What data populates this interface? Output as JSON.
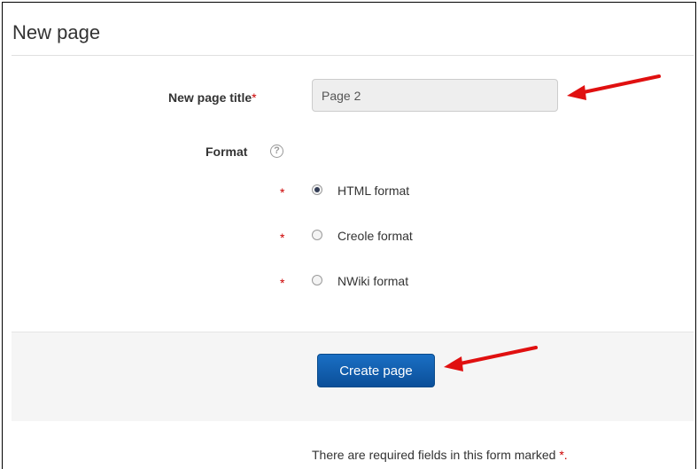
{
  "page": {
    "title": "New page"
  },
  "form": {
    "title_label": "New page title",
    "required_marker": "*",
    "title_value": "Page 2",
    "format_label": "Format",
    "help_glyph": "?",
    "formats": [
      {
        "label": "HTML format",
        "checked": true
      },
      {
        "label": "Creole format",
        "checked": false
      },
      {
        "label": "NWiki format",
        "checked": false
      }
    ],
    "submit_label": "Create page",
    "required_note": "There are required fields in this form marked",
    "required_note_marker": "*."
  },
  "colors": {
    "accent": "#0b4f99",
    "required": "#cc0000",
    "annotation_arrow": "#e01010"
  },
  "icons": {
    "help": "help-icon",
    "annotation": "red-arrow-icon"
  }
}
